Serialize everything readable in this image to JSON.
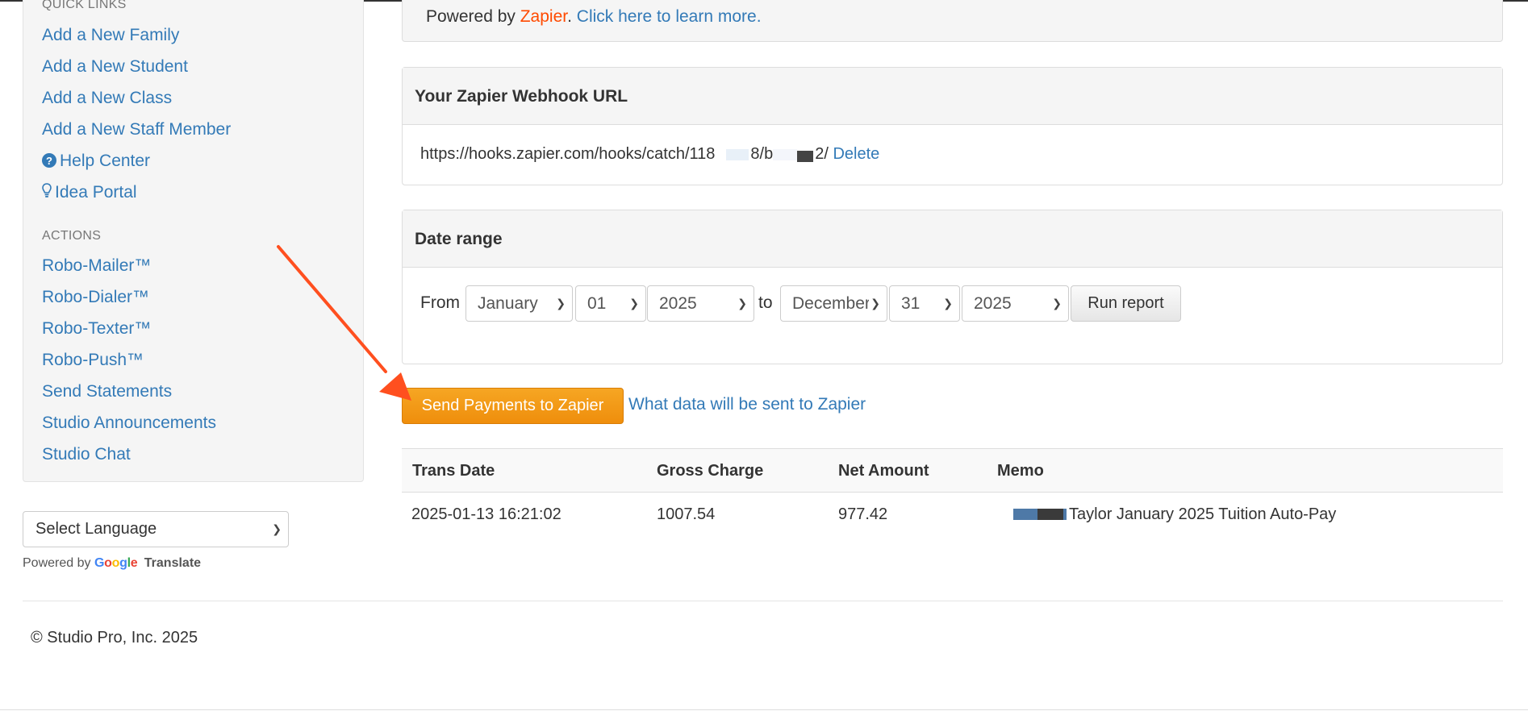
{
  "sidebar": {
    "quick_links_heading": "QUICK LINKS",
    "quick_links": [
      {
        "label": "Add a New Family"
      },
      {
        "label": "Add a New Student"
      },
      {
        "label": "Add a New Class"
      },
      {
        "label": "Add a New Staff Member"
      },
      {
        "label": "Help Center",
        "icon": "question-circle-icon"
      },
      {
        "label": "Idea Portal",
        "icon": "lightbulb-icon"
      }
    ],
    "actions_heading": "ACTIONS",
    "actions": [
      {
        "label": "Robo-Mailer™"
      },
      {
        "label": "Robo-Dialer™"
      },
      {
        "label": "Robo-Texter™"
      },
      {
        "label": "Robo-Push™"
      },
      {
        "label": "Send Statements"
      },
      {
        "label": "Studio Announcements"
      },
      {
        "label": "Studio Chat"
      }
    ]
  },
  "language": {
    "selected": "Select Language",
    "powered_by": "Powered by",
    "google": "Google",
    "translate": "Translate"
  },
  "zapier_info": {
    "powered_by": "Powered by ",
    "zapier": "Zapier",
    "period": ". ",
    "learn_more": "Click here to learn more."
  },
  "webhook": {
    "title": "Your Zapier Webhook URL",
    "url_part1": "https://hooks.zapier.com/hooks/catch/118",
    "url_part2": "8/b",
    "url_part3": "2/",
    "delete_label": "Delete"
  },
  "date_range": {
    "title": "Date range",
    "from_label": "From",
    "to_label": "to",
    "from_month": "January",
    "from_day": "01",
    "from_year": "2025",
    "to_month": "December",
    "to_day": "31",
    "to_year": "2025",
    "run_label": "Run report"
  },
  "send_button": "Send Payments to Zapier",
  "what_data_link": "What data will be sent to Zapier",
  "table": {
    "columns": [
      "Trans Date",
      "Gross Charge",
      "Net Amount",
      "Memo"
    ],
    "rows": [
      {
        "trans_date": "2025-01-13 16:21:02",
        "gross_charge": "1007.54",
        "net_amount": "977.42",
        "memo": "Taylor January 2025 Tuition Auto-Pay"
      }
    ]
  },
  "footer": {
    "copyright": "© Studio Pro, Inc. 2025"
  },
  "colors": {
    "link": "#337ab7",
    "zapier_orange": "#ff4a00",
    "send_button": "#f0950f",
    "annotation_arrow": "#ff4f1f"
  }
}
